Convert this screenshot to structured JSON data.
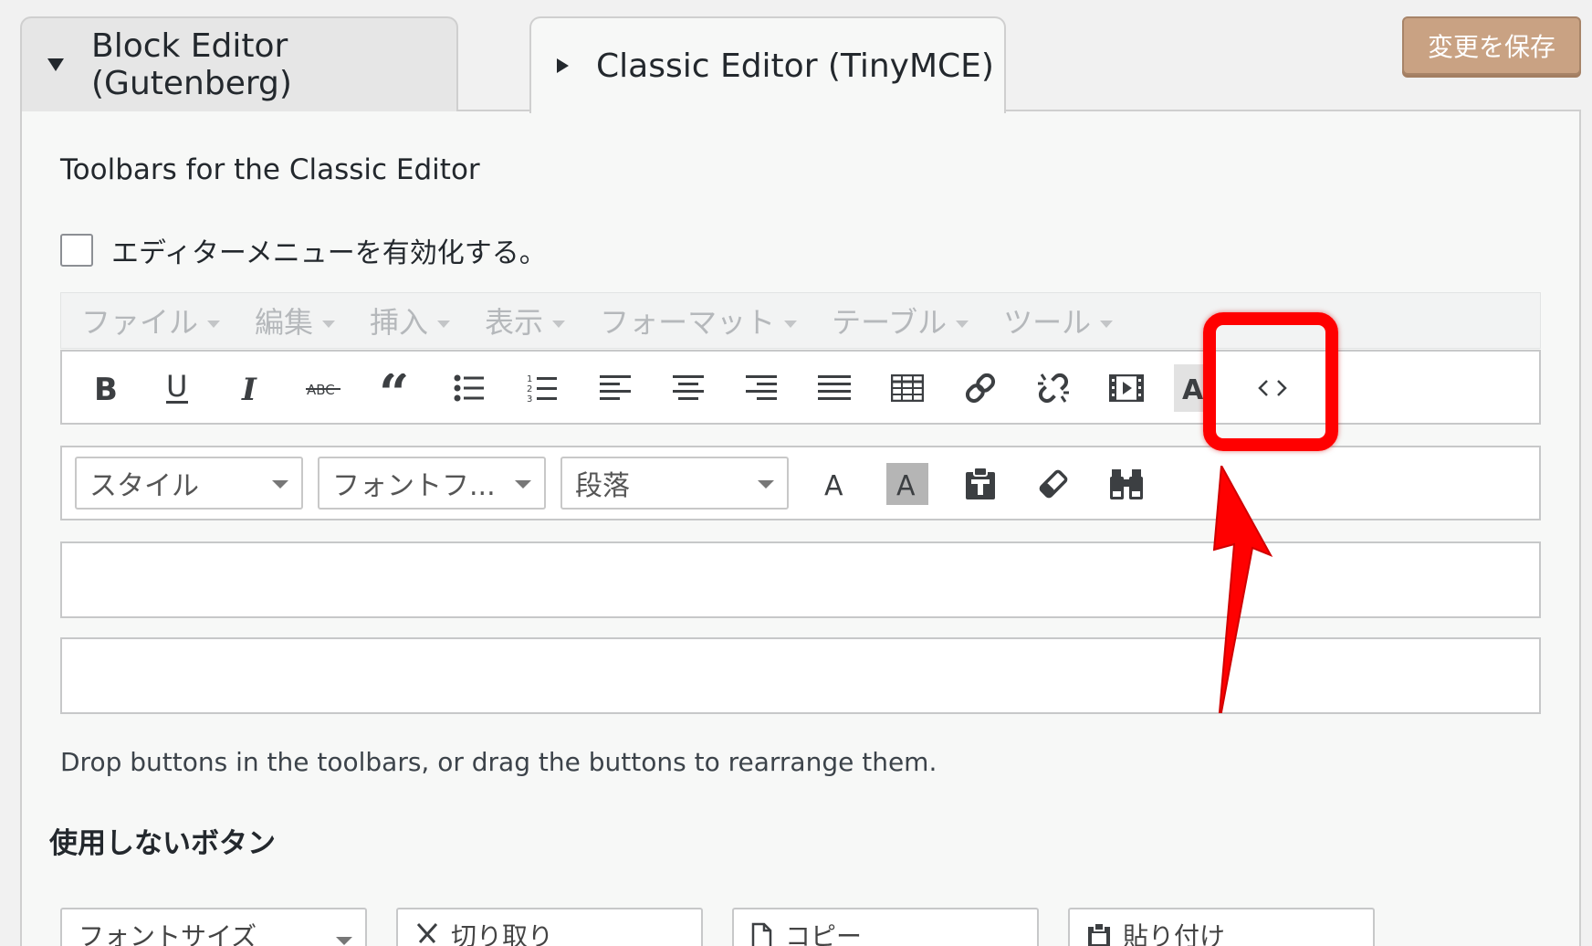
{
  "tabs": [
    {
      "label": "Block Editor (Gutenberg)",
      "expanded": true
    },
    {
      "label": "Classic Editor (TinyMCE)",
      "expanded": false
    }
  ],
  "save_button": "変更を保存",
  "section_title": "Toolbars for the Classic Editor",
  "enable_menu_label": "エディターメニューを有効化する。",
  "menubar": [
    "ファイル",
    "編集",
    "挿入",
    "表示",
    "フォーマット",
    "テーブル",
    "ツール"
  ],
  "toolbar1": [
    "bold-icon",
    "underline-icon",
    "italic-icon",
    "strikethrough-icon",
    "blockquote-icon",
    "bullet-list-icon",
    "numbered-list-icon",
    "align-left-icon",
    "align-center-icon",
    "align-right-icon",
    "align-justify-icon",
    "table-icon",
    "link-icon",
    "unlink-icon",
    "media-icon",
    "text-color-icon",
    "code-icon"
  ],
  "toolbar2": {
    "selects": [
      "スタイル",
      "フォントフ...",
      "段落"
    ],
    "icons": [
      "text-color-icon",
      "background-color-icon",
      "paste-text-icon",
      "clear-formatting-icon",
      "find-replace-icon"
    ],
    "glyph_a": "A"
  },
  "hint": "Drop buttons in the toolbars, or drag the buttons to rearrange them.",
  "unused_title": "使用しないボタン",
  "unused_buttons": [
    "フォントサイズ",
    "切り取り",
    "コピー",
    "貼り付け"
  ],
  "annotation_color": "#ff0000",
  "accent_color": "#c9a283"
}
